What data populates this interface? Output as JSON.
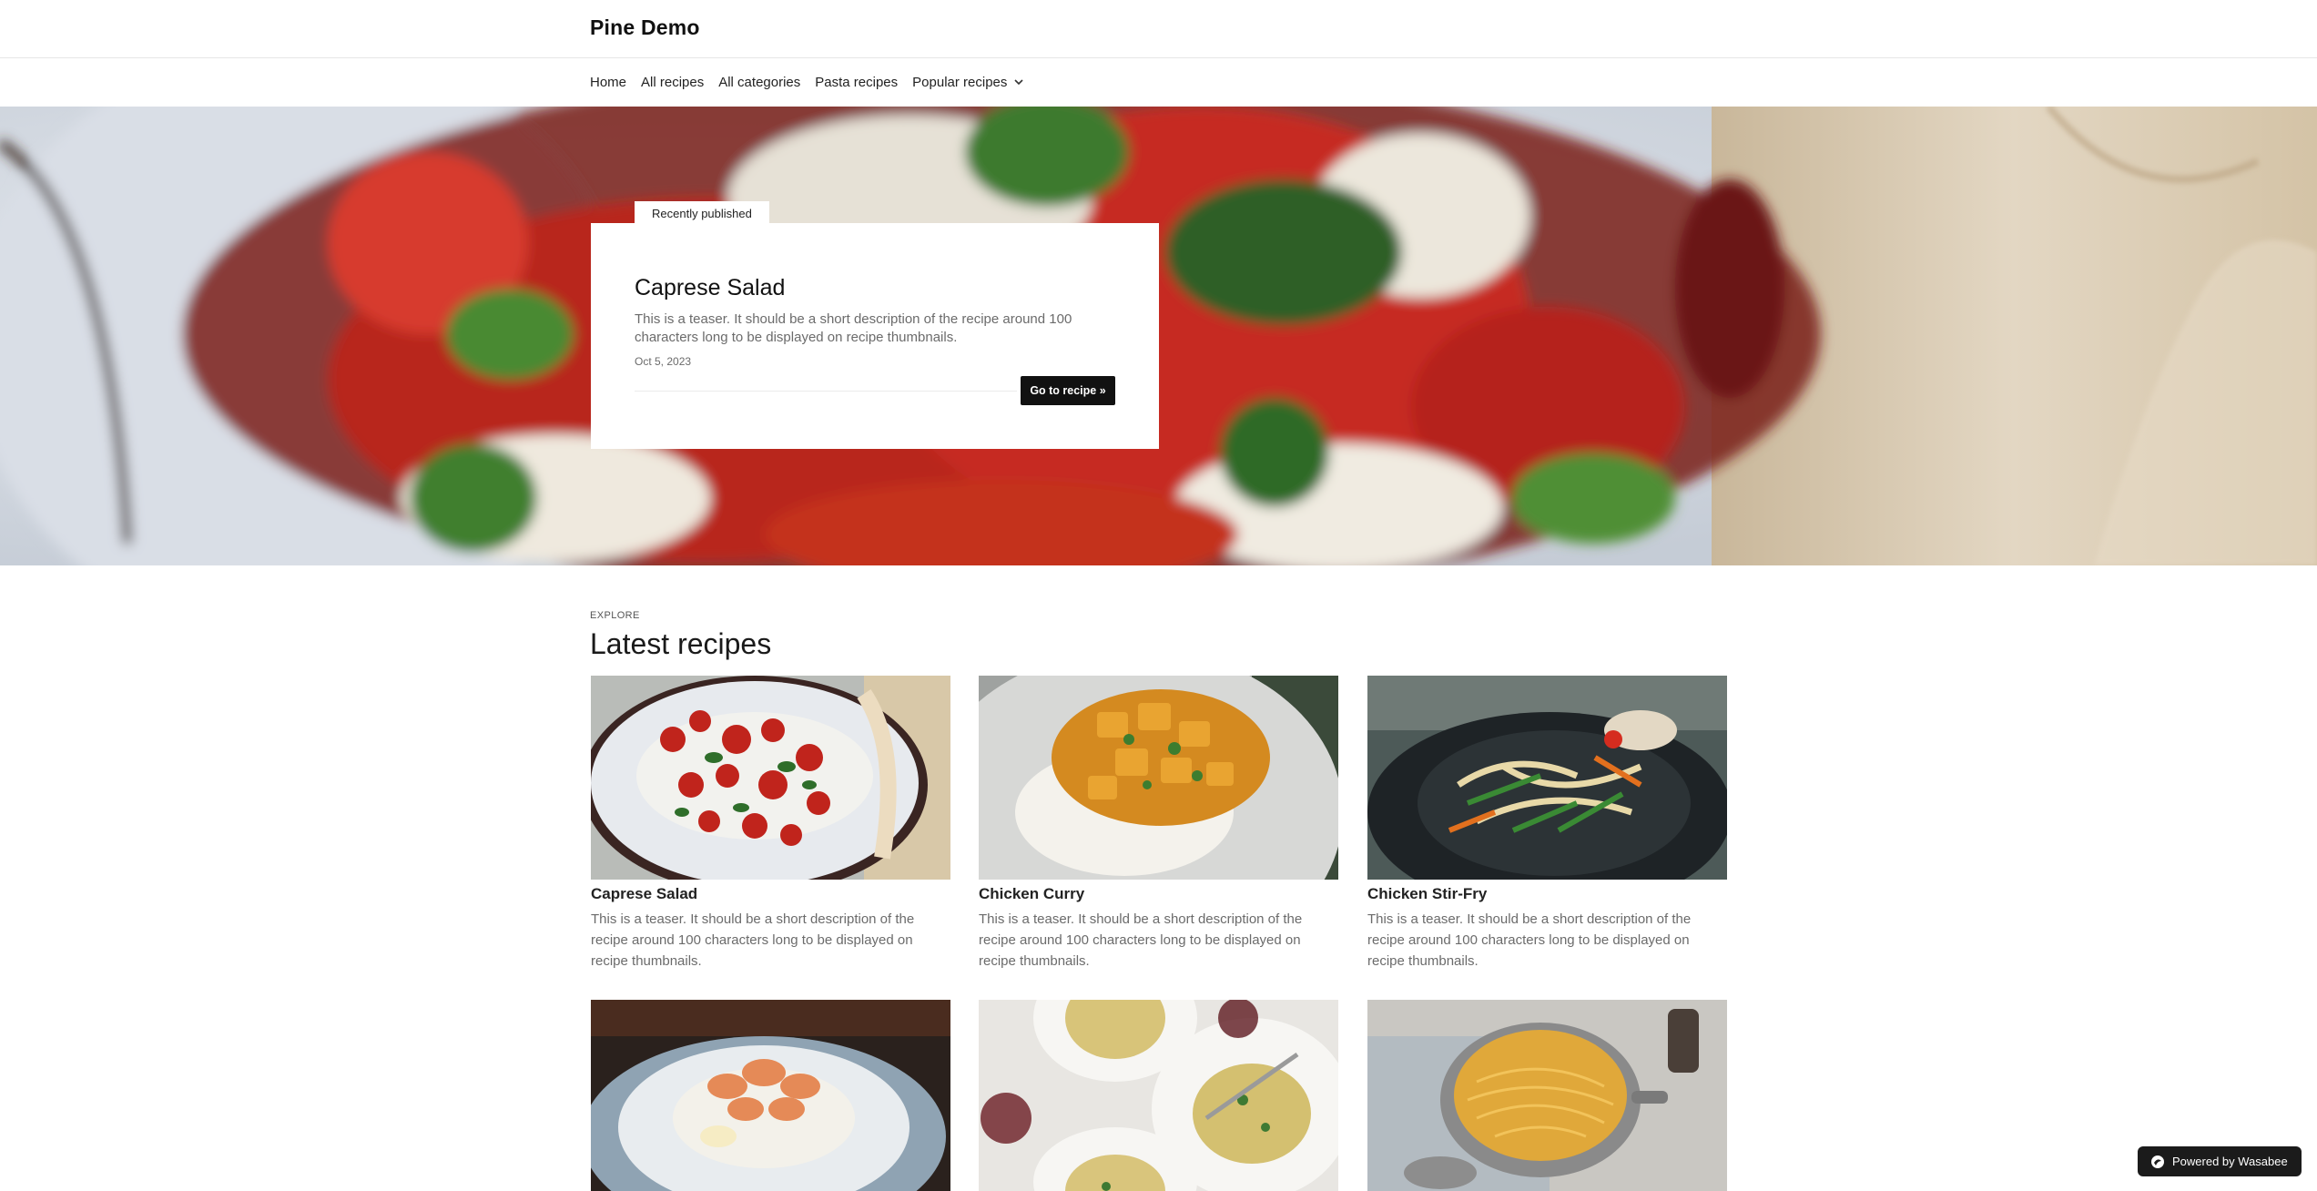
{
  "site": {
    "title": "Pine Demo"
  },
  "nav": {
    "items": [
      "Home",
      "All recipes",
      "All categories",
      "Pasta recipes",
      "Popular recipes"
    ]
  },
  "hero": {
    "tab_label": "Recently published",
    "title": "Caprese Salad",
    "teaser": "This is a teaser. It should be a short description of the recipe around 100 characters long to be displayed on recipe thumbnails.",
    "date": "Oct 5, 2023",
    "button_label": "Go to recipe »"
  },
  "latest": {
    "kicker": "EXPLORE",
    "title": "Latest recipes",
    "recipes": [
      {
        "title": "Caprese Salad",
        "teaser": "This is a teaser. It should be a short description of the recipe around 100 characters long to be displayed on recipe thumbnails."
      },
      {
        "title": "Chicken Curry",
        "teaser": "This is a teaser. It should be a short description of the recipe around 100 characters long to be displayed on recipe thumbnails."
      },
      {
        "title": "Chicken Stir-Fry",
        "teaser": "This is a teaser. It should be a short description of the recipe around 100 characters long to be displayed on recipe thumbnails."
      },
      {
        "title": "",
        "teaser": ""
      },
      {
        "title": "",
        "teaser": ""
      },
      {
        "title": "",
        "teaser": ""
      }
    ]
  },
  "badge": {
    "label": "Powered by Wasabee"
  },
  "colors": {
    "button_bg": "#111111",
    "text_muted": "#6b6b6b",
    "badge_bg": "#1b1b1b"
  }
}
